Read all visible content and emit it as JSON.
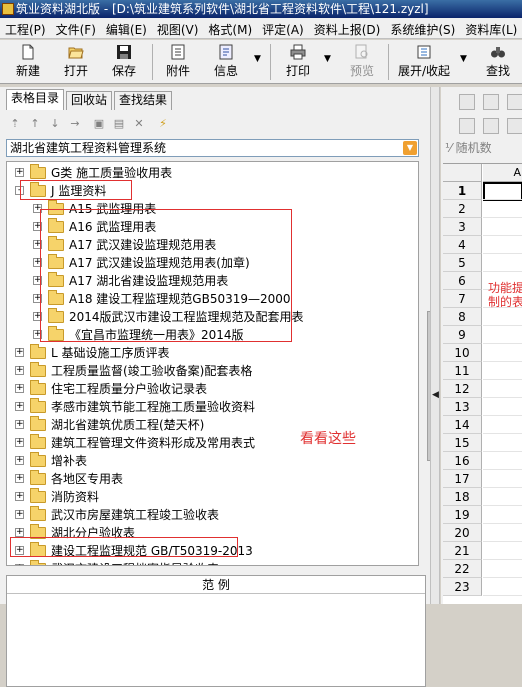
{
  "title": "筑业资料湖北版 - [D:\\筑业建筑系列软件\\湖北省工程资料软件\\工程\\121.zyzl]",
  "menu": [
    "工程(P)",
    "文件(F)",
    "编辑(E)",
    "视图(V)",
    "格式(M)",
    "评定(A)",
    "资料上报(D)",
    "系统维护(S)",
    "资料库(L)",
    "技"
  ],
  "toolbar": {
    "new": "新建",
    "open": "打开",
    "save": "保存",
    "attach": "附件",
    "info": "信息",
    "print": "打印",
    "preview": "预览",
    "expand": "展开/收起",
    "find": "查找"
  },
  "tabs": [
    "表格目录",
    "回收站",
    "查找结果"
  ],
  "combo": "湖北省建筑工程资料管理系统",
  "tree": [
    {
      "expander": "+",
      "text": "G类 施工质量验收用表"
    },
    {
      "expander": "-",
      "text": "J 监理资料"
    },
    {
      "expander": "+",
      "text": "A15 武监理用表"
    },
    {
      "expander": "+",
      "text": "A16 武监理用表"
    },
    {
      "expander": "+",
      "text": "A17 武汉建设监理规范用表"
    },
    {
      "expander": "+",
      "text": "A17 武汉建设监理规范用表(加章)"
    },
    {
      "expander": "+",
      "text": "A17 湖北省建设监理规范用表"
    },
    {
      "expander": "+",
      "text": "A18 建设工程监理规范GB50319—2000"
    },
    {
      "expander": "+",
      "text": "2014版武汉市建设工程监理规范及配套用表"
    },
    {
      "expander": "+",
      "text": "《宜昌市监理统一用表》2014版"
    },
    {
      "expander": "+",
      "text": "L 基础设施工序质评表"
    },
    {
      "expander": "+",
      "text": "工程质量监督(竣工验收备案)配套表格"
    },
    {
      "expander": "+",
      "text": "住宅工程质量分户验收记录表"
    },
    {
      "expander": "+",
      "text": "孝感市建筑节能工程施工质量验收资料"
    },
    {
      "expander": "+",
      "text": "湖北省建筑优质工程(楚天杯)"
    },
    {
      "expander": "+",
      "text": "建筑工程管理文件资料形成及常用表式"
    },
    {
      "expander": "+",
      "text": "增补表"
    },
    {
      "expander": "+",
      "text": "各地区专用表"
    },
    {
      "expander": "+",
      "text": "消防资料"
    },
    {
      "expander": "+",
      "text": "武汉市房屋建筑工程竣工验收表"
    },
    {
      "expander": "+",
      "text": "湖北分户验收表"
    },
    {
      "expander": "+",
      "text": "建设工程监理规范 GB/T50319-2013"
    },
    {
      "expander": "+",
      "text": "武汉市建设工程档案指导验收表"
    }
  ],
  "annotation": "看看这些",
  "example_header": "范     例",
  "right": {
    "random": "随机数",
    "col_a": "A",
    "rows": [
      "1",
      "2",
      "3",
      "4",
      "5",
      "6",
      "7",
      "8",
      "9",
      "10",
      "11",
      "12",
      "13",
      "14",
      "15",
      "16",
      "17",
      "18",
      "19",
      "20",
      "21",
      "22",
      "23"
    ],
    "note_line1": "功能提",
    "note_line2": "制的表"
  }
}
